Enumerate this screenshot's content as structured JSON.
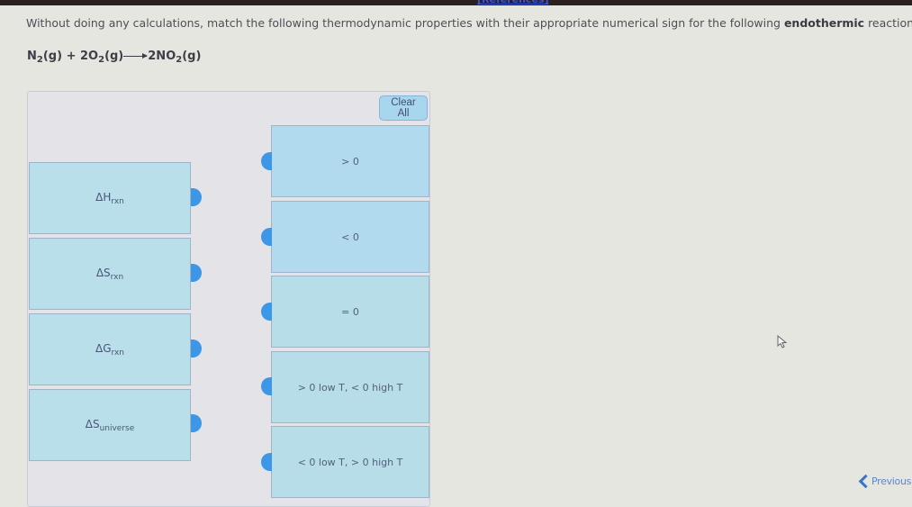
{
  "header": {
    "references_link": "[References]"
  },
  "question": {
    "instruction_prefix": "Without doing any calculations, match the following thermodynamic properties with their appropriate numerical sign for the following ",
    "instruction_bold": "endothermic",
    "instruction_suffix": " reaction.",
    "equation": {
      "reactant1": "N",
      "reactant1_sub": "2",
      "reactant1_state": "(g) + 2O",
      "reactant2_sub": "2",
      "reactant2_state": "(g)",
      "product": "2NO",
      "product_sub": "2",
      "product_state": "(g)"
    }
  },
  "matching": {
    "clear_all_label": "Clear All",
    "properties": [
      {
        "symbol": "ΔH",
        "subscript": "rxn"
      },
      {
        "symbol": "ΔS",
        "subscript": "rxn"
      },
      {
        "symbol": "ΔG",
        "subscript": "rxn"
      },
      {
        "symbol": "ΔS",
        "subscript": "universe"
      }
    ],
    "signs": [
      {
        "label": "> 0"
      },
      {
        "label": "< 0"
      },
      {
        "label": "= 0"
      },
      {
        "label": "> 0 low T, < 0 high T"
      },
      {
        "label": "< 0 low T, > 0 high T"
      }
    ]
  },
  "navigation": {
    "previous_label": "Previous"
  },
  "colors": {
    "accent_blue": "#3e96e6",
    "card_blue": "#b2daee",
    "link_blue": "#3a55d8"
  }
}
